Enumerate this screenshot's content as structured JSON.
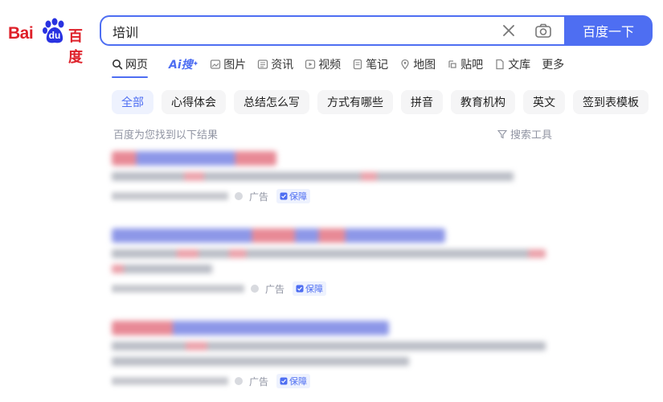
{
  "logo": {
    "latin": "Bai",
    "paw_text": "du",
    "chinese": "百度"
  },
  "search": {
    "query": "培训",
    "button_label": "百度一下"
  },
  "tabs": [
    {
      "label": "网页",
      "icon": "search-icon",
      "active": true
    },
    {
      "label": "Ai搜",
      "icon": "",
      "active": false
    },
    {
      "label": "图片",
      "icon": "image-icon",
      "active": false
    },
    {
      "label": "资讯",
      "icon": "news-icon",
      "active": false
    },
    {
      "label": "视频",
      "icon": "video-icon",
      "active": false
    },
    {
      "label": "笔记",
      "icon": "note-icon",
      "active": false
    },
    {
      "label": "地图",
      "icon": "map-icon",
      "active": false
    },
    {
      "label": "贴吧",
      "icon": "tieba-icon",
      "active": false
    },
    {
      "label": "文库",
      "icon": "doc-icon",
      "active": false
    },
    {
      "label": "更多",
      "icon": "",
      "active": false
    }
  ],
  "chips": [
    {
      "label": "全部",
      "active": true
    },
    {
      "label": "心得体会",
      "active": false
    },
    {
      "label": "总结怎么写",
      "active": false
    },
    {
      "label": "方式有哪些",
      "active": false
    },
    {
      "label": "拼音",
      "active": false
    },
    {
      "label": "教育机构",
      "active": false
    },
    {
      "label": "英文",
      "active": false
    },
    {
      "label": "签到表模板",
      "active": false
    }
  ],
  "result_info": {
    "count_text": "百度为您找到以下结果",
    "tools_label": "搜索工具"
  },
  "results": [
    {
      "ad_label": "广告",
      "guarantee_label": "保障"
    },
    {
      "ad_label": "广告",
      "guarantee_label": "保障"
    },
    {
      "ad_label": "广告",
      "guarantee_label": "保障"
    }
  ],
  "colors": {
    "brand_blue": "#4e6ef2",
    "logo_red": "#de2029",
    "muted_gray": "#9195a3"
  }
}
